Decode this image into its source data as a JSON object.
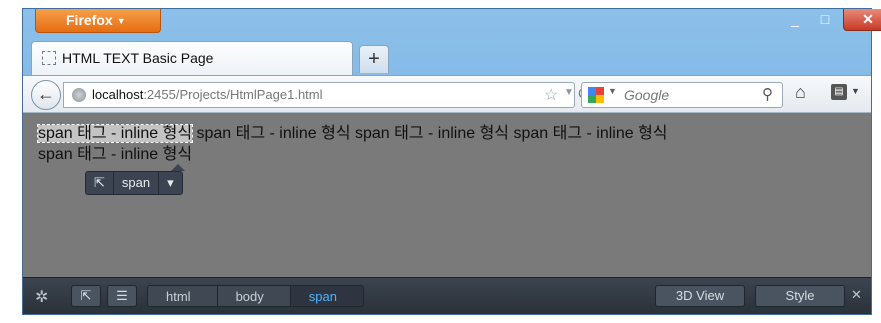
{
  "window": {
    "firefox_label": "Firefox",
    "minimize": "_",
    "maximize": "□",
    "close": "✕"
  },
  "tab": {
    "title": "HTML TEXT Basic Page",
    "new_tab": "+"
  },
  "navbar": {
    "back": "←",
    "url_host": "localhost",
    "url_rest": ":2455/Projects/HtmlPage1.html",
    "star": "☆",
    "dropmark": "▼",
    "reload": "C",
    "search_placeholder": "Google",
    "search_drop": "▼",
    "search_go": "⚲",
    "home": "⌂",
    "bookmarks": "▤",
    "bookmarks_drop": "▼"
  },
  "content": {
    "highlighted_span": "span 태그 - inline 형식",
    "rest_line1": " span 태그 - inline 형식 span 태그 - inline 형식 span 태그 - inline 형식",
    "line2": "span 태그 - inline 형식"
  },
  "infobar": {
    "pick_icon": "⇱",
    "node_label": "span",
    "dropdown": "▾"
  },
  "devtools": {
    "gear": "✲",
    "inspect_icon": "⇱",
    "markup_icon": "☰",
    "breadcrumbs": [
      "html",
      "body",
      "span"
    ],
    "view3d": "3D View",
    "style": "Style",
    "close": "✕"
  }
}
